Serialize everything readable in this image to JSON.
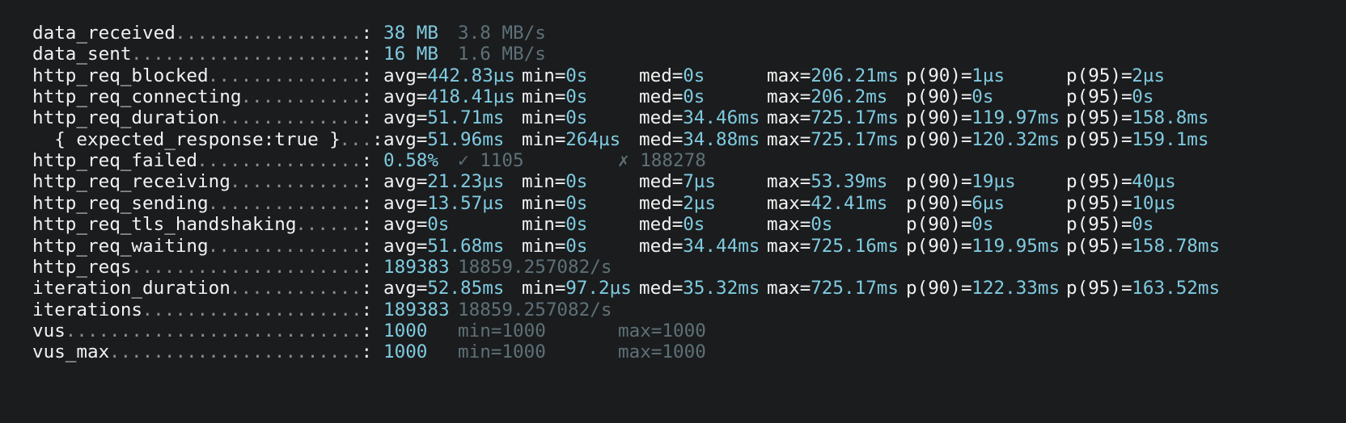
{
  "metrics": [
    {
      "name": "data_received",
      "dots": ".................",
      "colon": ":",
      "value": "38 MB",
      "rate": "3.8 MB/s"
    },
    {
      "name": "data_sent",
      "dots": ".....................",
      "colon": ":",
      "value": "16 MB",
      "rate": "1.6 MB/s"
    },
    {
      "name": "http_req_blocked",
      "dots": "..............",
      "colon": ":",
      "stats": {
        "avg": "442.83µs",
        "min": "0s",
        "med": "0s",
        "max": "206.21ms",
        "p90": "1µs",
        "p95": "2µs"
      }
    },
    {
      "name": "http_req_connecting",
      "dots": "...........",
      "colon": ":",
      "stats": {
        "avg": "418.41µs",
        "min": "0s",
        "med": "0s",
        "max": "206.2ms",
        "p90": "0s",
        "p95": "0s"
      }
    },
    {
      "name": "http_req_duration",
      "dots": ".............",
      "colon": ":",
      "stats": {
        "avg": "51.71ms",
        "min": "0s",
        "med": "34.46ms",
        "max": "725.17ms",
        "p90": "119.97ms",
        "p95": "158.8ms"
      }
    },
    {
      "name": "  { expected_response:true }",
      "dots": "...",
      "colon": ":",
      "stats": {
        "avg": "51.96ms",
        "min": "264µs",
        "med": "34.88ms",
        "max": "725.17ms",
        "p90": "120.32ms",
        "p95": "159.1ms"
      }
    },
    {
      "name": "http_req_failed",
      "dots": "...............",
      "colon": ":",
      "value": "0.58%",
      "passes": "✓ 1105",
      "fails": "✗ 188278"
    },
    {
      "name": "http_req_receiving",
      "dots": "............",
      "colon": ":",
      "stats": {
        "avg": "21.23µs",
        "min": "0s",
        "med": "7µs",
        "max": "53.39ms",
        "p90": "19µs",
        "p95": "40µs"
      }
    },
    {
      "name": "http_req_sending",
      "dots": "..............",
      "colon": ":",
      "stats": {
        "avg": "13.57µs",
        "min": "0s",
        "med": "2µs",
        "max": "42.41ms",
        "p90": "6µs",
        "p95": "10µs"
      }
    },
    {
      "name": "http_req_tls_handshaking",
      "dots": "......",
      "colon": ":",
      "stats": {
        "avg": "0s",
        "min": "0s",
        "med": "0s",
        "max": "0s",
        "p90": "0s",
        "p95": "0s"
      }
    },
    {
      "name": "http_req_waiting",
      "dots": "..............",
      "colon": ":",
      "stats": {
        "avg": "51.68ms",
        "min": "0s",
        "med": "34.44ms",
        "max": "725.16ms",
        "p90": "119.95ms",
        "p95": "158.78ms"
      }
    },
    {
      "name": "http_reqs",
      "dots": ".....................",
      "colon": ":",
      "value": "189383",
      "rate": "18859.257082/s"
    },
    {
      "name": "iteration_duration",
      "dots": "............",
      "colon": ":",
      "stats": {
        "avg": "52.85ms",
        "min": "97.2µs",
        "med": "35.32ms",
        "max": "725.17ms",
        "p90": "122.33ms",
        "p95": "163.52ms"
      }
    },
    {
      "name": "iterations",
      "dots": "....................",
      "colon": ":",
      "value": "189383",
      "rate": "18859.257082/s"
    },
    {
      "name": "vus",
      "dots": "...........................",
      "colon": ":",
      "value": "1000",
      "min": "min=1000",
      "max": "max=1000"
    },
    {
      "name": "vus_max",
      "dots": ".......................",
      "colon": ":",
      "value": "1000",
      "min": "min=1000",
      "max": "max=1000"
    }
  ],
  "labels": {
    "avg": "avg=",
    "min": "min=",
    "med": "med=",
    "max": "max=",
    "p90": "p(90)=",
    "p95": "p(95)="
  },
  "colors": {
    "background": "#1b1c1e",
    "text": "#f2f2f2",
    "value": "#7fcbe0",
    "dim": "#5e7178"
  }
}
